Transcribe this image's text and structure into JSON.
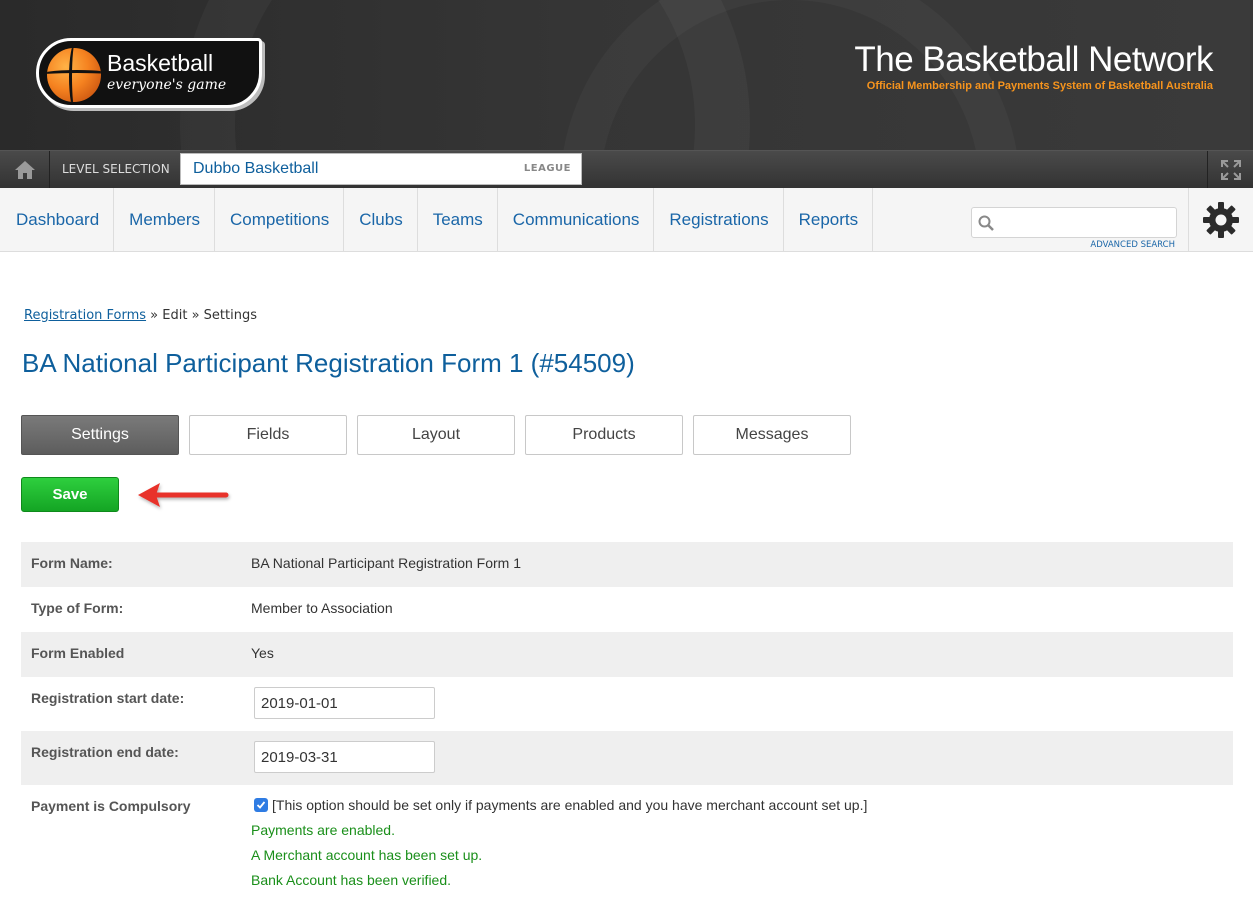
{
  "header": {
    "logo_title": "Basketball",
    "logo_subtitle": "everyone's game",
    "brand_title": "The Basketball Network",
    "brand_subtitle": "Official Membership and Payments System of Basketball Australia"
  },
  "level": {
    "label": "LEVEL SELECTION",
    "name": "Dubbo Basketball",
    "type": "LEAGUE"
  },
  "nav": {
    "items": [
      "Dashboard",
      "Members",
      "Competitions",
      "Clubs",
      "Teams",
      "Communications",
      "Registrations",
      "Reports"
    ],
    "search_placeholder": "",
    "advanced_search": "ADVANCED SEARCH"
  },
  "breadcrumb": {
    "link": "Registration Forms",
    "rest": " » Edit » Settings"
  },
  "page_title": "BA National Participant Registration Form 1 (#54509)",
  "tabs": [
    "Settings",
    "Fields",
    "Layout",
    "Products",
    "Messages"
  ],
  "active_tab": "Settings",
  "save_label": "Save",
  "form": {
    "form_name_label": "Form Name:",
    "form_name_value": "BA National Participant Registration Form 1",
    "type_label": "Type of Form:",
    "type_value": "Member to Association",
    "enabled_label": "Form Enabled",
    "enabled_value": "Yes",
    "start_label": "Registration start date:",
    "start_value": "2019-01-01",
    "end_label": "Registration end date:",
    "end_value": "2019-03-31",
    "payment_label": "Payment is Compulsory",
    "payment_checked": true,
    "payment_note": "[This option should be set only if payments are enabled and you have merchant account set up.]",
    "status_1": "Payments are enabled.",
    "status_2": "A Merchant account has been set up.",
    "status_3": "Bank Account has been verified."
  },
  "colors": {
    "link_blue": "#0e5f9c",
    "save_green": "#14a524",
    "arrow_red": "#e8322a",
    "status_green": "#1a8f1a"
  }
}
